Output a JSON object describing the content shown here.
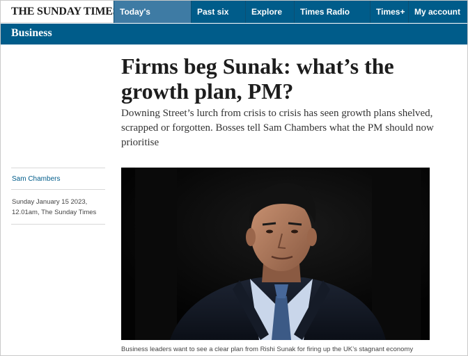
{
  "brand": {
    "logo_text": "THE SUNDAY TIMES"
  },
  "nav": {
    "sections_label": "Today's sections",
    "past_label": "Past six days",
    "explore_label": "Explore",
    "radio_label": "Times Radio",
    "timesplus_label": "Times+",
    "account_label": "My account"
  },
  "section": {
    "title": "Business"
  },
  "article": {
    "headline": "Firms beg Sunak: what’s the growth plan, PM?",
    "standfirst": "Downing Street’s lurch from crisis to crisis has seen growth plans shelved, scrapped or forgotten. Bosses tell Sam Chambers what the PM should now prioritise",
    "author": "Sam Chambers",
    "date_line1": "Sunday January 15 2023,",
    "date_line2": "12.01am, The Sunday Times",
    "caption": "Business leaders want to see a clear plan from Rishi Sunak for firing up the UK’s stagnant economy"
  },
  "colors": {
    "nav_blue": "#005c8a",
    "nav_active": "#3e7ba4",
    "link_blue": "#005c8a"
  }
}
